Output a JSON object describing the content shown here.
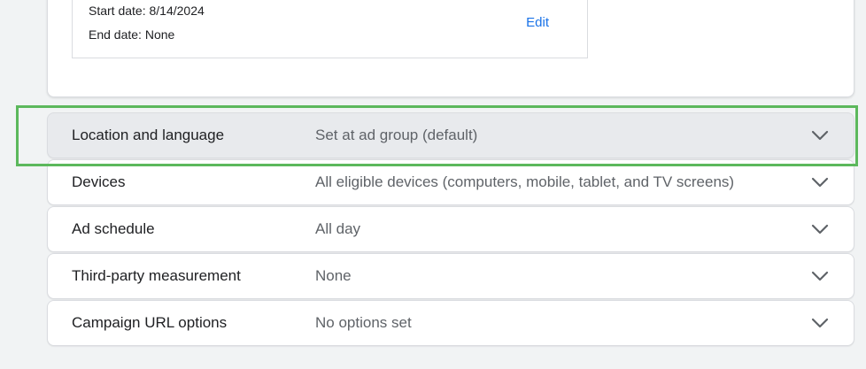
{
  "schedule": {
    "start_date": "Start date: 8/14/2024",
    "end_date": "End date: None",
    "edit_label": "Edit"
  },
  "settings": {
    "rows": [
      {
        "label": "Location and language",
        "value": "Set at ad group (default)"
      },
      {
        "label": "Devices",
        "value": "All eligible devices (computers, mobile, tablet, and TV screens)"
      },
      {
        "label": "Ad schedule",
        "value": "All day"
      },
      {
        "label": "Third-party measurement",
        "value": "None"
      },
      {
        "label": "Campaign URL options",
        "value": "No options set"
      }
    ]
  },
  "colors": {
    "link": "#1a73e8",
    "highlight": "#5cb85c",
    "active_row": "#e8eaed"
  },
  "icons": {
    "expand": "chevron-down-icon"
  }
}
